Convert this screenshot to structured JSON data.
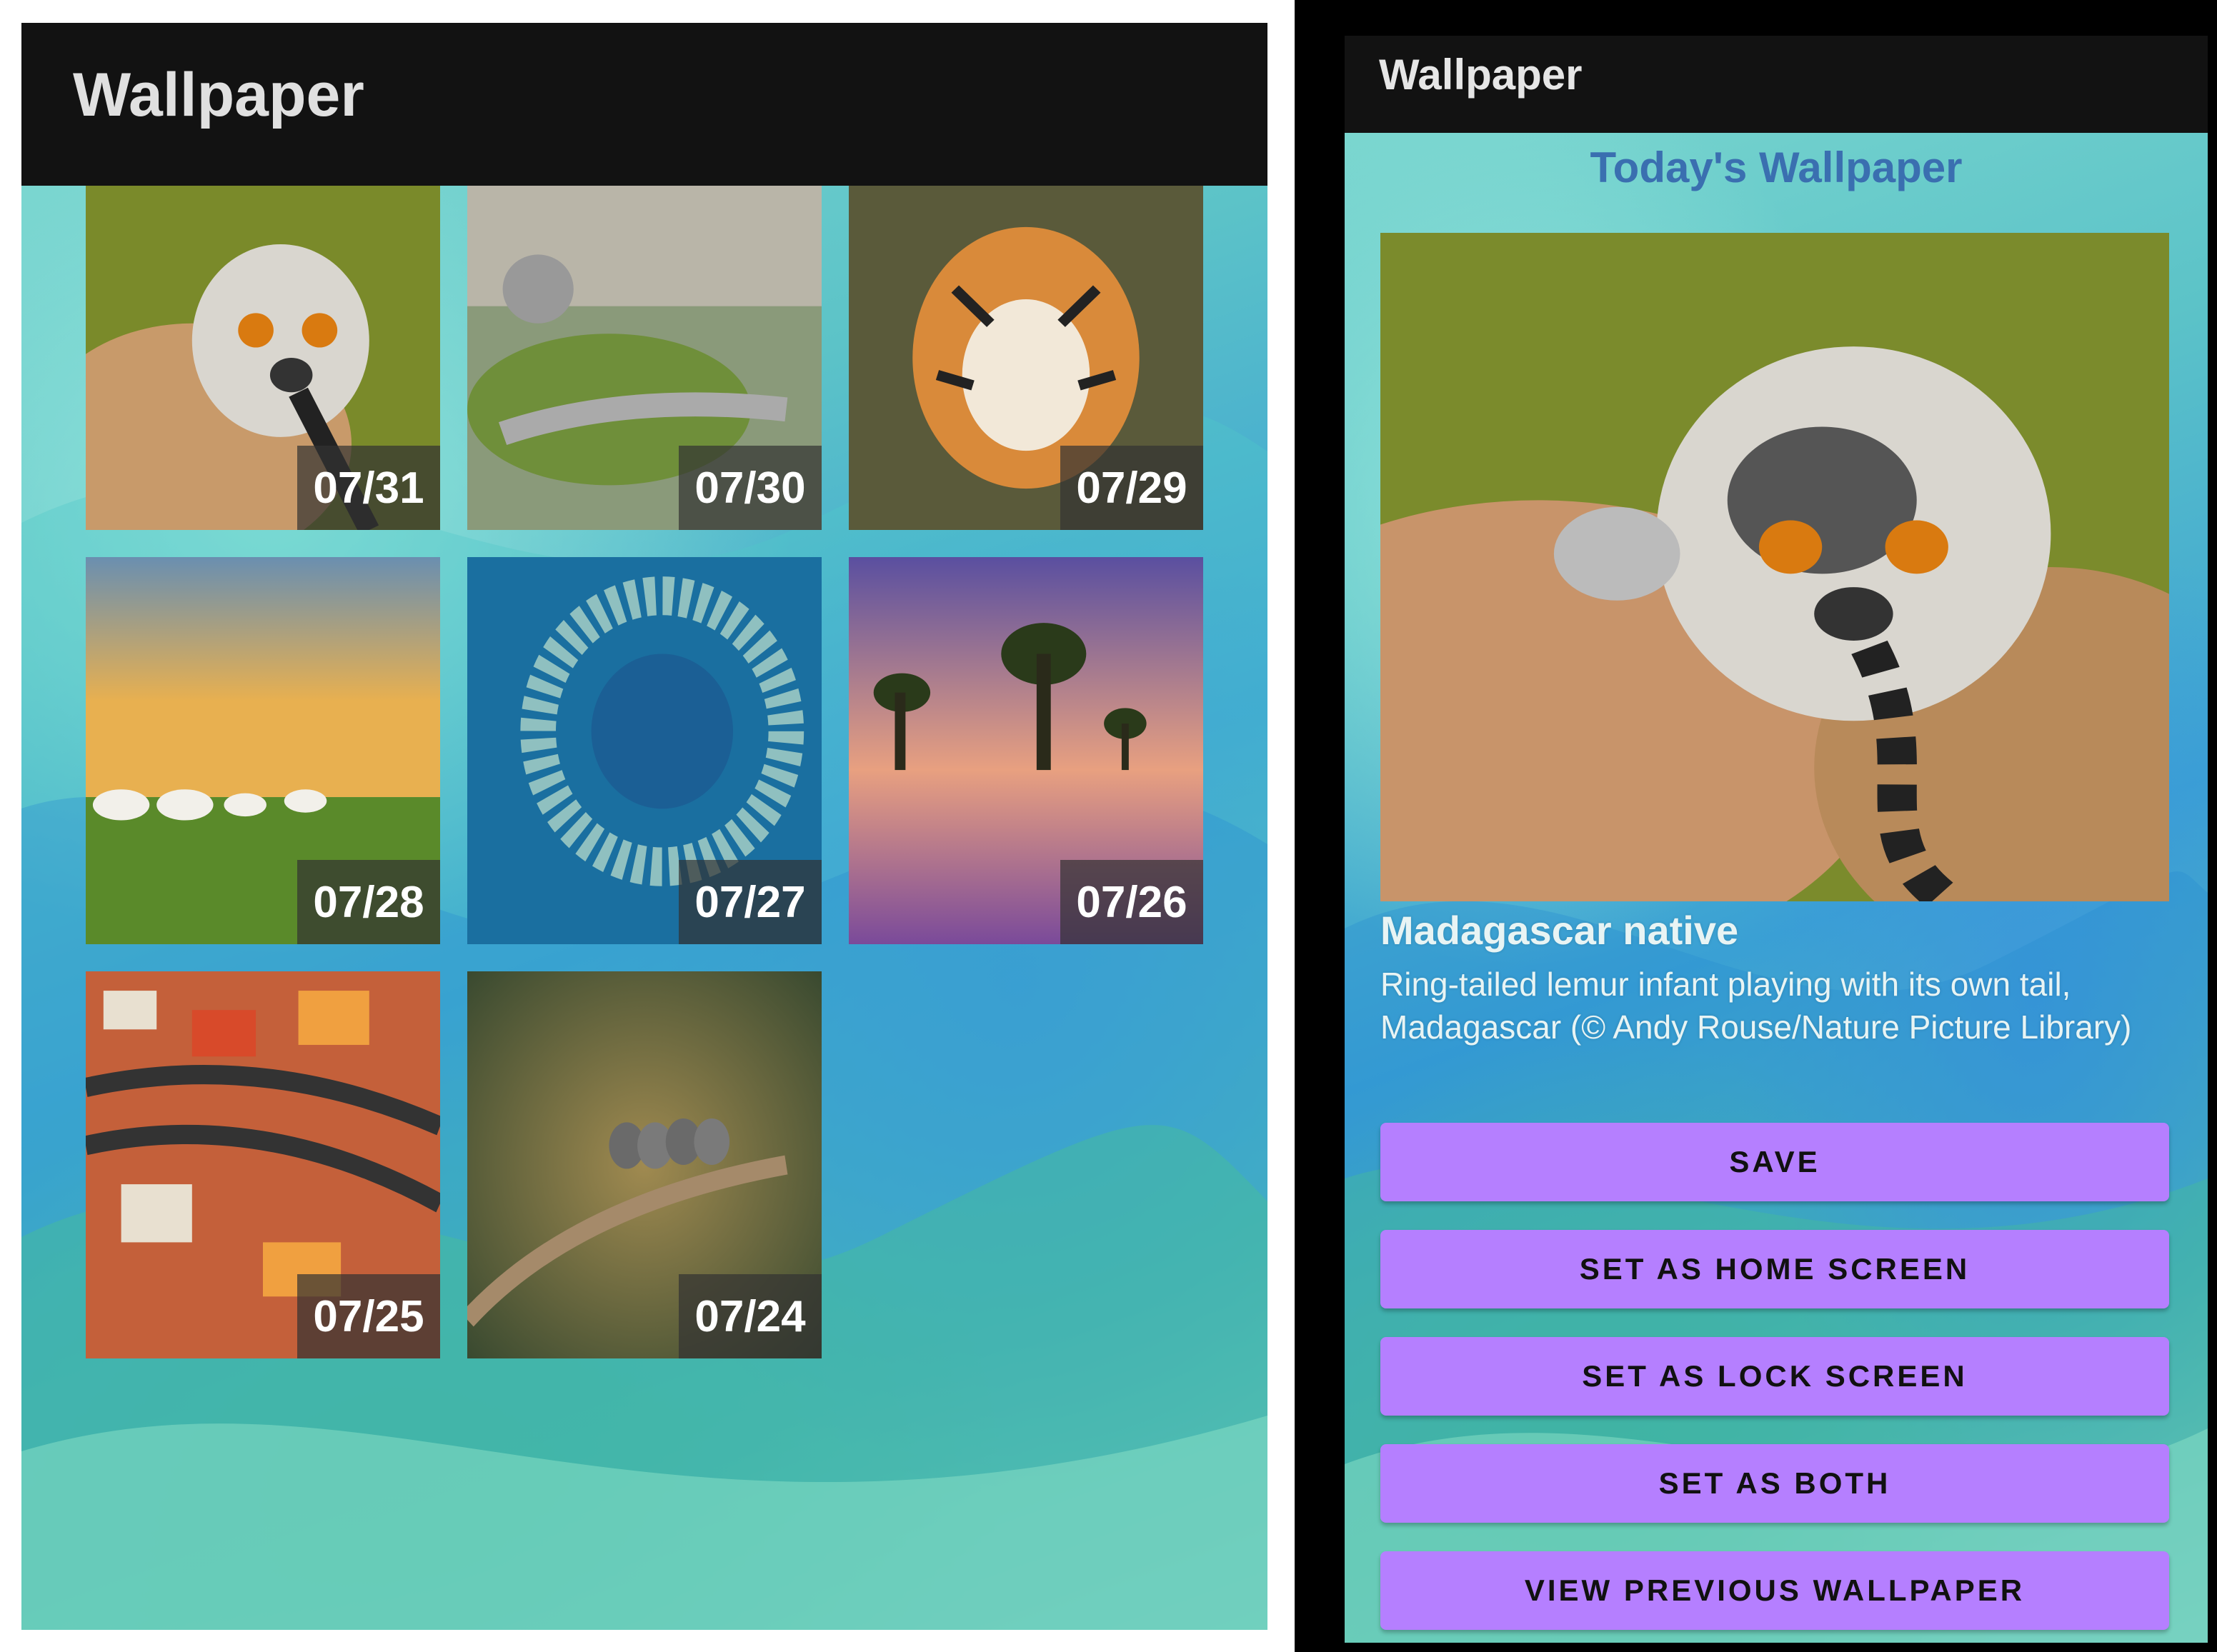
{
  "left": {
    "app_title": "Wallpaper",
    "tiles": [
      {
        "date": "07/31",
        "subject": "ring-tailed lemur"
      },
      {
        "date": "07/30",
        "subject": "aerial park with hands sculpture"
      },
      {
        "date": "07/29",
        "subject": "tiger"
      },
      {
        "date": "07/28",
        "subject": "yurts on grassland at sunset"
      },
      {
        "date": "07/27",
        "subject": "school of barracuda"
      },
      {
        "date": "07/26",
        "subject": "mangrove trees at dusk"
      },
      {
        "date": "07/25",
        "subject": "aerial city rooftops"
      },
      {
        "date": "07/24",
        "subject": "birds on a branch"
      }
    ]
  },
  "right": {
    "app_title": "Wallpaper",
    "heading": "Today's Wallpaper",
    "image_title": "Madagascar native",
    "image_description": "Ring-tailed lemur infant playing with its own tail, Madagascar (© Andy Rouse/Nature Picture Library)",
    "buttons": {
      "save": "SAVE",
      "home": "SET AS HOME SCREEN",
      "lock": "SET AS LOCK SCREEN",
      "both": "SET AS BOTH",
      "previous": "VIEW PREVIOUS WALLPAPER"
    }
  },
  "colors": {
    "appbar": "#121212",
    "button": "#b57fff",
    "heading": "#3a6fb0"
  }
}
